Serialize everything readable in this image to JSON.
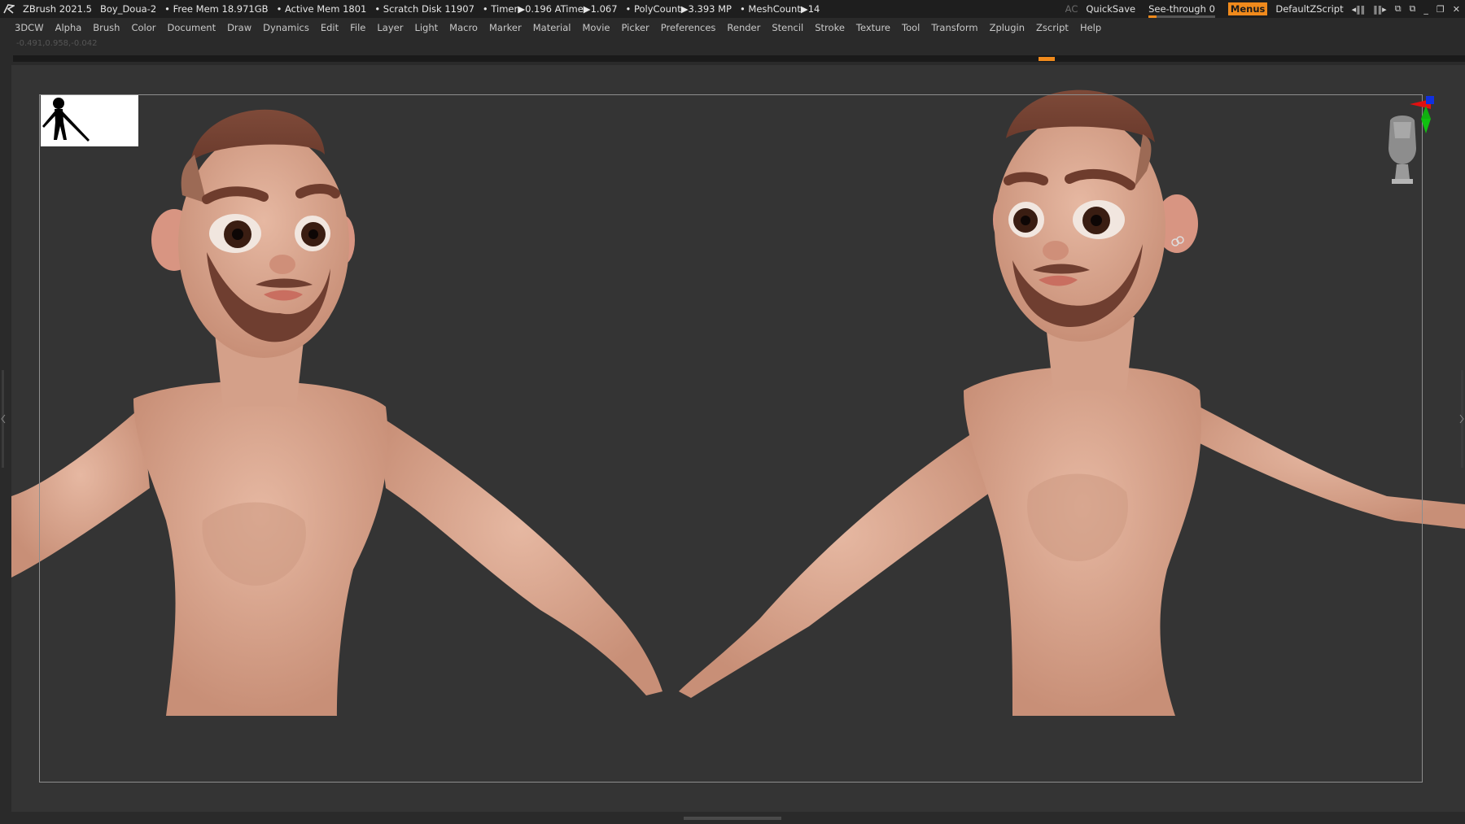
{
  "titlebar": {
    "app_title": "ZBrush 2021.5",
    "document_name": "Boy_Doua-2",
    "free_mem": "• Free Mem 18.971GB",
    "active_mem": "• Active Mem 1801",
    "scratch_disk": "• Scratch Disk 11907",
    "timer": "• Timer▶0.196 ATime▶1.067",
    "polycount": "• PolyCount▶3.393 MP",
    "meshcount": "• MeshCount▶14",
    "ac_label": "AC",
    "quicksave_label": "QuickSave",
    "see_through_label": "See-through",
    "see_through_value": "0",
    "menus_label": "Menus",
    "script_label": "DefaultZScript"
  },
  "menu_items": [
    "3DCW",
    "Alpha",
    "Brush",
    "Color",
    "Document",
    "Draw",
    "Dynamics",
    "Edit",
    "File",
    "Layer",
    "Light",
    "Macro",
    "Marker",
    "Material",
    "Movie",
    "Picker",
    "Preferences",
    "Render",
    "Stencil",
    "Stroke",
    "Texture",
    "Tool",
    "Transform",
    "Zplugin",
    "Zscript",
    "Help"
  ],
  "coord_readout": "-0.491,0.958,-0.042",
  "colors": {
    "accent": "#f08a1c",
    "skin": "#d9a790",
    "hair": "#7b4838",
    "background": "#343434"
  },
  "icons": [
    "zbrush-logo-icon",
    "minimize-icon",
    "restore-icon",
    "close-icon",
    "axis-gizmo-icon",
    "head-navigator-icon"
  ]
}
